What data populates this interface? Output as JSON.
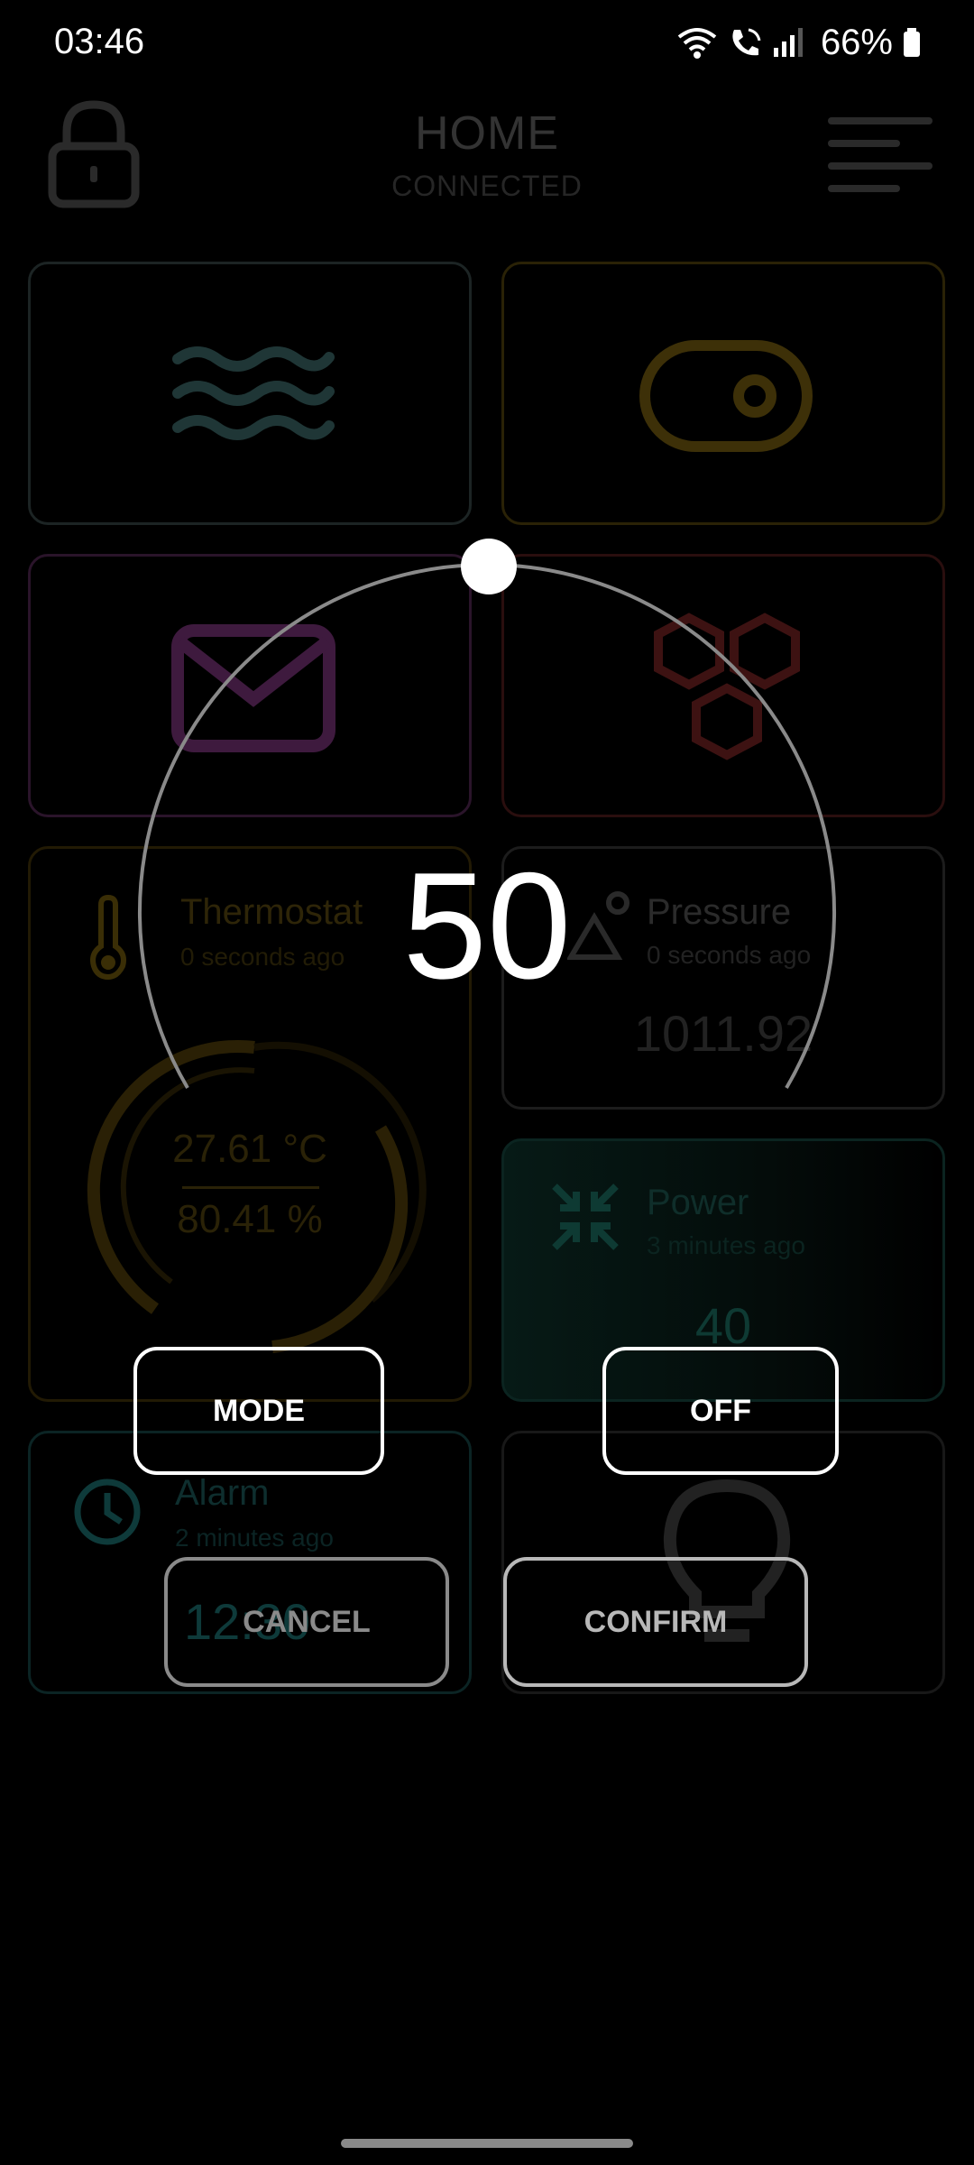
{
  "status_bar": {
    "time": "03:46",
    "battery_percent": "66%",
    "icons": [
      "wifi-icon",
      "wifi-call-icon",
      "signal-icon",
      "battery-icon"
    ]
  },
  "header": {
    "title": "HOME",
    "subtitle": "CONNECTED",
    "left_icon": "lock-icon",
    "right_icon": "menu-icon"
  },
  "tiles": {
    "water": {
      "icon": "waves-icon",
      "color": "#1f3a3a"
    },
    "switch": {
      "icon": "toggle-icon",
      "color": "#4a3a08"
    },
    "mail": {
      "icon": "mail-icon",
      "color": "#4a1f4a"
    },
    "hex": {
      "icon": "hexagons-icon",
      "color": "#4a1414"
    },
    "thermostat": {
      "title": "Thermostat",
      "ago": "0 seconds ago",
      "temperature": "27.61 °C",
      "humidity": "80.41 %",
      "icon": "thermometer-icon",
      "color": "#4a3a08"
    },
    "pressure": {
      "title": "Pressure",
      "ago": "0 seconds ago",
      "value": "1011.92",
      "icon": "pressure-icon"
    },
    "power": {
      "title": "Power",
      "ago": "3 minutes ago",
      "value": "40",
      "icon": "compress-icon",
      "color": "#0e3a33"
    },
    "alarm": {
      "title": "Alarm",
      "ago": "2 minutes ago",
      "value": "12:30",
      "icon": "clock-icon",
      "color": "#0e3a3a"
    },
    "light": {
      "icon": "bulb-icon"
    }
  },
  "dialog": {
    "value": "50",
    "level_fraction": 0.5,
    "mode_label": "MODE",
    "off_label": "OFF",
    "cancel_label": "CANCEL",
    "confirm_label": "CONFIRM"
  }
}
